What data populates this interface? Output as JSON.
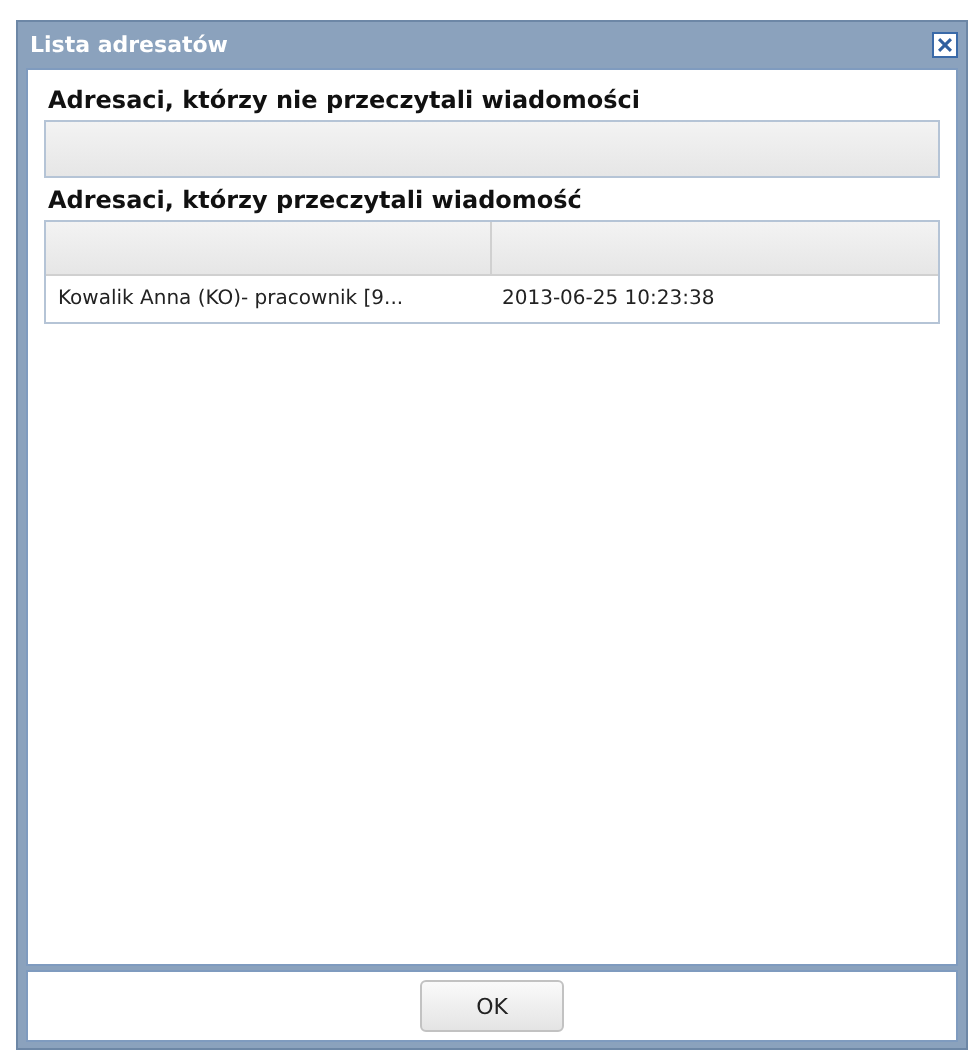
{
  "window": {
    "title": "Lista adresatów"
  },
  "unread_section": {
    "heading": "Adresaci, którzy nie przeczytali wiadomości"
  },
  "read_section": {
    "heading": "Adresaci, którzy przeczytali wiadomość",
    "rows": [
      {
        "column_1": "Kowalik Anna (KO)- pracownik [9...",
        "column_2": "2013-06-25 10:23:38"
      }
    ]
  },
  "buttons": [
    "OK"
  ]
}
